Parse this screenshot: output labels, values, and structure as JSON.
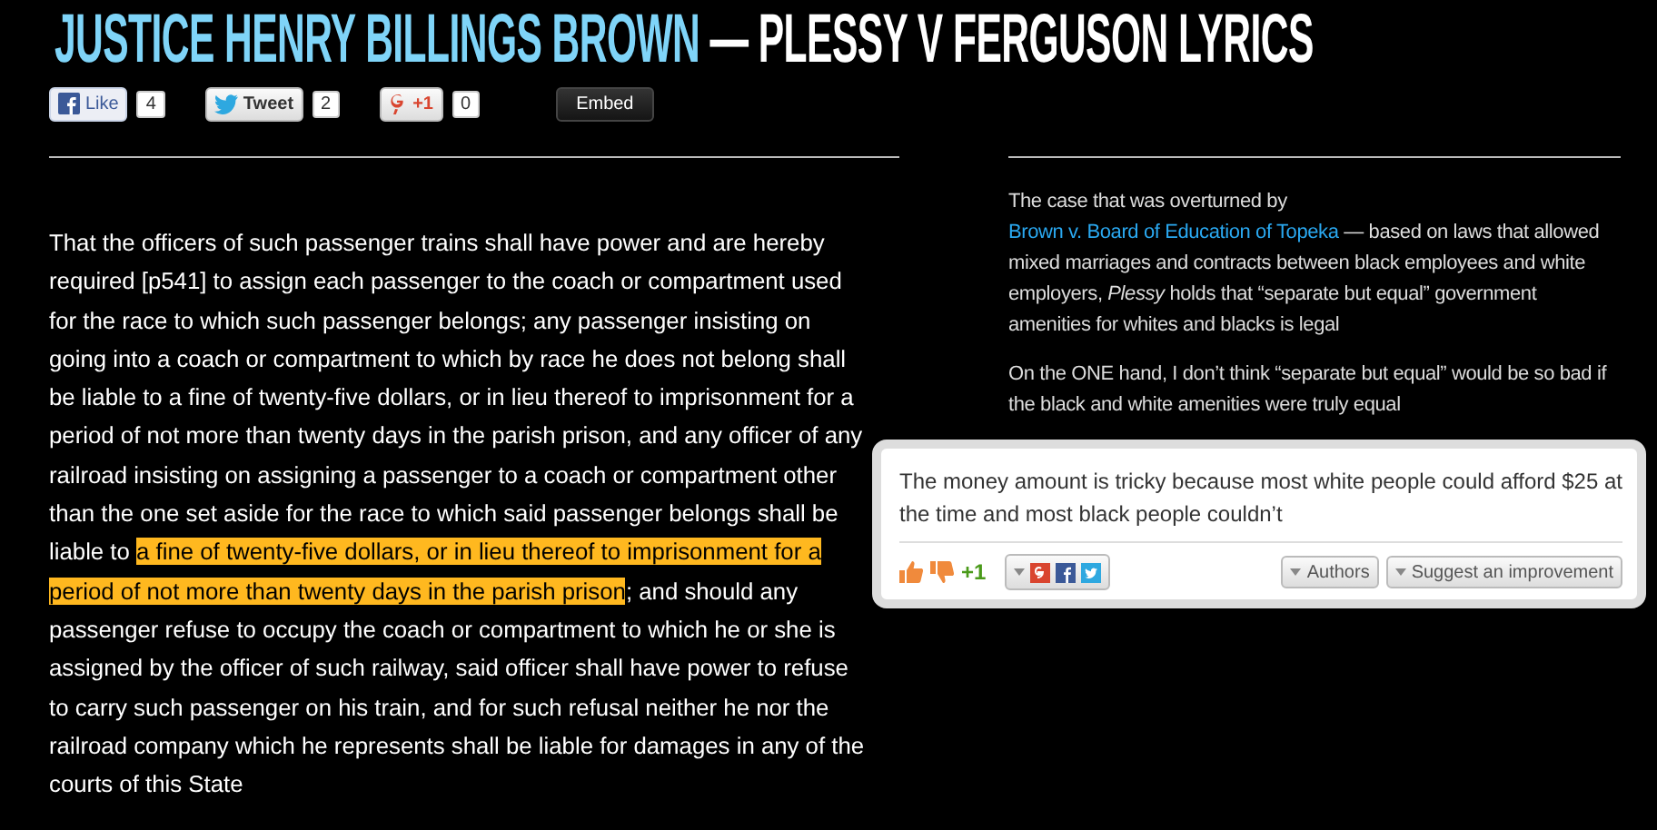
{
  "title": {
    "artist": "JUSTICE HENRY BILLINGS BROWN",
    "separator": "—",
    "song": "PLESSY V FERGUSON LYRICS"
  },
  "share": [
    {
      "kind": "facebook",
      "label": "Like",
      "count": "4"
    },
    {
      "kind": "twitter",
      "label": "Tweet",
      "count": "2"
    },
    {
      "kind": "gplus",
      "label": "+1",
      "count": "0"
    }
  ],
  "embed": "Embed",
  "lyrics": [
    {
      "text": "That the officers of such passenger trains shall have power and are hereby required [p541] to assign each passenger to the coach or compartment used for the race to which such passenger belongs; any passenger insisting on going into a coach or compartment to which by race he does not belong shall be liable to a fine of twenty-five dollars, or in lieu thereof to imprisonment for a period of not more than twenty days in the parish prison, and any officer of any railroad insisting on assigning a passenger to a coach or compartment other than the one set aside for the race to which said passenger belongs shall be liable to ",
      "highlighted": false
    },
    {
      "text": "a fine of twenty-five dollars, or in lieu thereof to imprisonment for a period of not more than twenty days in the parish prison",
      "highlighted": true
    },
    {
      "text": "; and should any passenger refuse to occupy the coach or compartment to which he or she is assigned by the officer of such railway, said officer shall have power to refuse to carry such passenger on his train, and for such refusal neither he nor the railroad company which he represents shall be liable for damages in any of the courts of this State",
      "highlighted": false
    }
  ],
  "annotation": {
    "paragraphs": [
      [
        {
          "kind": "text",
          "text": "The case that was overturned by "
        },
        {
          "kind": "link",
          "text": "Brown v. Board of Education of Topeka"
        },
        {
          "kind": "text",
          "text": " — based on laws that allowed mixed marriages and contracts between black employees and white employers, *Plessy* holds that “separate but equal” government amenities for whites and blacks is legal"
        }
      ],
      [
        {
          "kind": "text",
          "text": "On the ONE hand, I don’t think “separate but equal” would be so bad if the black and white amenities were truly equal"
        }
      ]
    ]
  },
  "comment": {
    "text": "The money amount is tricky because most white people could afford $25 at the time and most black people couldn’t",
    "score": "+1",
    "buttons": [
      "Authors",
      "Suggest an improvement"
    ]
  }
}
